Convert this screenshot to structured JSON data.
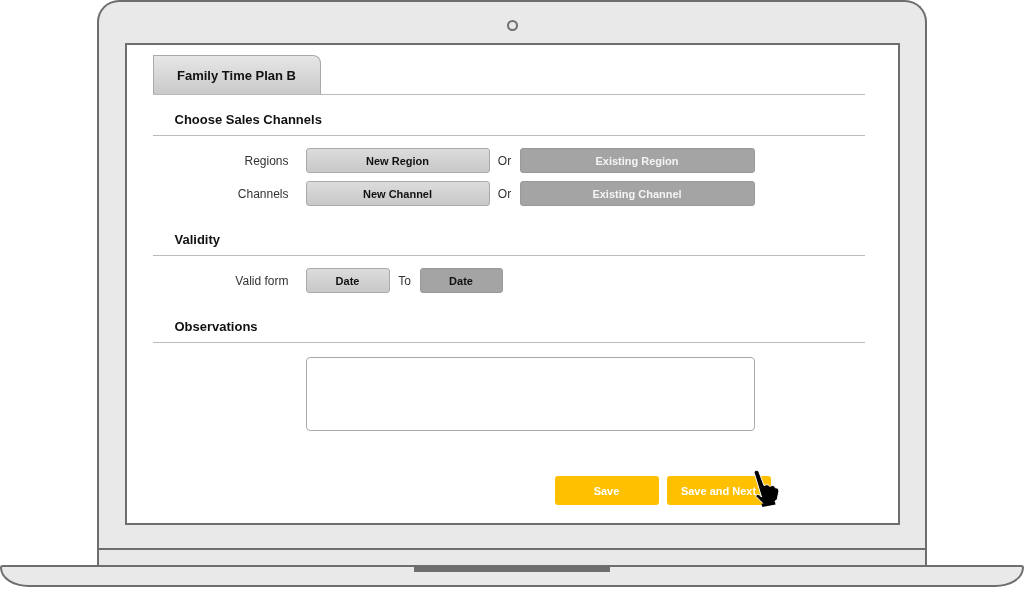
{
  "tabs": [
    {
      "label": "Family Time Plan B",
      "selected": true
    }
  ],
  "sections": [
    {
      "title": "Choose Sales Channels",
      "rows": [
        {
          "label": "Regions",
          "items": [
            {
              "kind": "light",
              "text": "New Region"
            },
            {
              "kind": "connector",
              "text": "Or"
            },
            {
              "kind": "dark",
              "text": "Existing Region"
            }
          ]
        },
        {
          "label": "Channels",
          "items": [
            {
              "kind": "light",
              "text": "New Channel"
            },
            {
              "kind": "connector",
              "text": "Or"
            },
            {
              "kind": "dark",
              "text": "Existing Channel"
            }
          ]
        }
      ]
    },
    {
      "title": "Validity",
      "rows": [
        {
          "label": "Valid form",
          "items": [
            {
              "kind": "light-short",
              "text": "Date"
            },
            {
              "kind": "connector",
              "text": "To"
            },
            {
              "kind": "dark-short",
              "text": "Date"
            }
          ]
        }
      ]
    },
    {
      "title": "Observations",
      "rows": [
        {
          "items": [
            {
              "kind": "textarea"
            }
          ]
        }
      ]
    }
  ],
  "actions": [
    {
      "label": "Save"
    },
    {
      "label": "Save and Next"
    }
  ]
}
